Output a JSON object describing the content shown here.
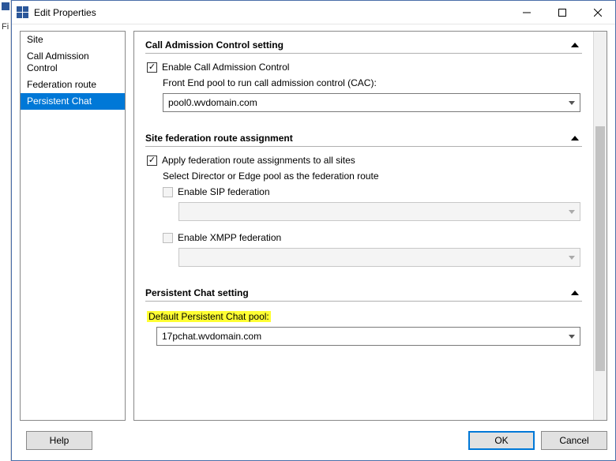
{
  "window": {
    "title": "Edit Properties"
  },
  "left_strip": {
    "label": "Fi"
  },
  "nav": {
    "items": [
      {
        "label": "Site",
        "selected": false
      },
      {
        "label": "Call Admission Control",
        "selected": false
      },
      {
        "label": "Federation route",
        "selected": false
      },
      {
        "label": "Persistent Chat",
        "selected": true
      }
    ]
  },
  "sections": {
    "cac": {
      "title": "Call Admission Control setting",
      "enable_label": "Enable Call Admission Control",
      "enable_checked": true,
      "pool_label": "Front End pool to run call admission control (CAC):",
      "pool_value": "pool0.wvdomain.com"
    },
    "fed": {
      "title": "Site federation route assignment",
      "apply_label": "Apply federation route assignments to all sites",
      "apply_checked": true,
      "select_label": "Select Director or Edge pool as the federation route",
      "sip_label": "Enable SIP federation",
      "sip_checked": false,
      "sip_value": "",
      "xmpp_label": "Enable XMPP federation",
      "xmpp_checked": false,
      "xmpp_value": ""
    },
    "pchat": {
      "title": "Persistent Chat setting",
      "default_label": "Default Persistent Chat pool:",
      "value": "17pchat.wvdomain.com"
    }
  },
  "footer": {
    "help": "Help",
    "ok": "OK",
    "cancel": "Cancel"
  }
}
